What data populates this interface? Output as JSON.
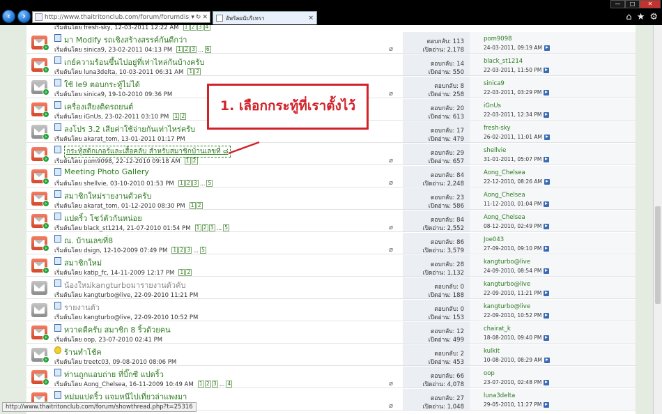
{
  "browser": {
    "url": "http://www.thaitritonclub.com/forum/forumdisplay.ph",
    "tab_title": "อัพรัลผนับริเทรา",
    "tab_close": "×",
    "window_buttons": [
      "—",
      "□",
      "✕"
    ],
    "status_url": "http://www.thaitritonclub.com/forum/showthread.php?t=25316"
  },
  "top_row": {
    "starter": "เริ่มต้นโดย fresh-sky, 12-03-2011 12:22 AM",
    "pages": [
      "1",
      "2",
      "3",
      "4"
    ]
  },
  "threads": [
    {
      "title": "มา Modify รถเชิงสร้างสรรค์กันดีกว่า",
      "state": "hot",
      "new": true,
      "icon": "doc",
      "grey": false,
      "boxed": false,
      "starter": "เริ่มต้นโดย sinica9, 23-02-2011 04:13 PM",
      "pages": [
        "1",
        "2",
        "3",
        "...",
        "6"
      ],
      "attach": true,
      "replies": "ตอบกลับ: 113",
      "views": "เปิดอ่าน: 2,178",
      "lp_user": "pom9098",
      "lp_date": "24-03-2011, 09:19 AM"
    },
    {
      "title": "เกย์ความร้อนขึ้นไปอยู่ที่เท่าไหล่กันบ้างครับ",
      "state": "hot",
      "new": true,
      "icon": "doc",
      "grey": false,
      "boxed": false,
      "starter": "เริ่มต้นโดย luna3delta, 10-03-2011 06:31 AM",
      "pages": [
        "1",
        "2"
      ],
      "attach": false,
      "replies": "ตอบกลับ: 14",
      "views": "เปิดอ่าน: 550",
      "lp_user": "black_st1214",
      "lp_date": "22-03-2011, 11:50 PM"
    },
    {
      "title": "ใช้ Ie9 ตอบกระทู้ไม่ได้",
      "state": "cold",
      "new": true,
      "icon": "doc",
      "grey": false,
      "boxed": false,
      "starter": "เริ่มต้นโดย sinica9, 19-10-2010 09:36 PM",
      "pages": [],
      "attach": true,
      "replies": "ตอบกลับ: 8",
      "views": "เปิดอ่าน: 258",
      "lp_user": "sinica9",
      "lp_date": "22-03-2011, 03:29 PM"
    },
    {
      "title": "เครื่องเสียงติดรถยนต์",
      "state": "hot",
      "new": true,
      "icon": "doc",
      "grey": false,
      "boxed": false,
      "starter": "เริ่มต้นโดย iGnUs, 23-02-2011 03:10 PM",
      "pages": [
        "1",
        "2"
      ],
      "attach": false,
      "replies": "ตอบกลับ: 20",
      "views": "เปิดอ่าน: 613",
      "lp_user": "iGnUs",
      "lp_date": "22-03-2011, 12:34 PM"
    },
    {
      "title": "ลงโปร 3.2 เสียค่าใช้จ่ายกันเท่าไหร่ครับ",
      "state": "cold",
      "new": true,
      "icon": "doc",
      "grey": false,
      "boxed": false,
      "starter": "เริ่มต้นโดย akarat_tom, 13-01-2011 01:17 PM",
      "pages": [],
      "attach": false,
      "replies": "ตอบกลับ: 17",
      "views": "เปิดอ่าน: 479",
      "lp_user": "fresh-sky",
      "lp_date": "26-02-2011, 11:01 AM"
    },
    {
      "title": "กระทู้สติกเกอร์และเสื้อคลับ สำหรับสมาชิกบ้านเลขที่ ๘",
      "state": "hot",
      "new": true,
      "icon": "doc",
      "grey": false,
      "boxed": true,
      "starter": "เริ่มต้นโดย pom9098, 22-12-2010 09:18 AM",
      "pages": [
        "1",
        "2"
      ],
      "attach": true,
      "replies": "ตอบกลับ: 29",
      "views": "เปิดอ่าน: 657",
      "lp_user": "shellvie",
      "lp_date": "31-01-2011, 05:07 PM"
    },
    {
      "title": "Meeting Photo Gallery",
      "state": "hot",
      "new": true,
      "icon": "doc",
      "grey": false,
      "boxed": false,
      "starter": "เริ่มต้นโดย shellvie, 03-10-2010 01:53 PM",
      "pages": [
        "1",
        "2",
        "3",
        "...",
        "5"
      ],
      "attach": true,
      "replies": "ตอบกลับ: 84",
      "views": "เปิดอ่าน: 2,248",
      "lp_user": "Aong_Chelsea",
      "lp_date": "22-12-2010, 08:26 AM"
    },
    {
      "title": "สมาชิกใหม่รายงานตัวครับ",
      "state": "hot",
      "new": true,
      "icon": "doc",
      "grey": false,
      "boxed": false,
      "starter": "เริ่มต้นโดย akarat_tom, 01-12-2010 08:30 PM",
      "pages": [
        "1",
        "2"
      ],
      "attach": false,
      "replies": "ตอบกลับ: 23",
      "views": "เปิดอ่าน: 586",
      "lp_user": "Aong_Chelsea",
      "lp_date": "11-12-2010, 01:04 PM"
    },
    {
      "title": "แปดริ้ว โชว์ตัวกันหน่อย",
      "state": "hot",
      "new": true,
      "icon": "doc",
      "grey": false,
      "boxed": false,
      "starter": "เริ่มต้นโดย black_st1214, 21-07-2010 01:54 PM",
      "pages": [
        "1",
        "2",
        "3",
        "...",
        "5"
      ],
      "attach": true,
      "replies": "ตอบกลับ: 84",
      "views": "เปิดอ่าน: 2,552",
      "lp_user": "Aong_Chelsea",
      "lp_date": "08-12-2010, 02:49 PM"
    },
    {
      "title": "ณ. บ้านเลขที่8",
      "state": "hot",
      "new": true,
      "icon": "doc",
      "grey": false,
      "boxed": false,
      "starter": "เริ่มต้นโดย dsign, 12-10-2009 07:49 PM",
      "pages": [
        "1",
        "2",
        "3",
        "...",
        "5"
      ],
      "attach": true,
      "replies": "ตอบกลับ: 86",
      "views": "เปิดอ่าน: 3,579",
      "lp_user": "Joe043",
      "lp_date": "27-09-2010, 09:10 PM"
    },
    {
      "title": "สมาชิกใหม่",
      "state": "hot",
      "new": true,
      "icon": "doc",
      "grey": false,
      "boxed": false,
      "starter": "เริ่มต้นโดย katip_fc, 14-11-2009 12:17 PM",
      "pages": [
        "1",
        "2"
      ],
      "attach": false,
      "replies": "ตอบกลับ: 28",
      "views": "เปิดอ่าน: 1,132",
      "lp_user": "kangturbo@live",
      "lp_date": "24-09-2010, 08:54 PM"
    },
    {
      "title": "น้องใหม่kangturboมารายงานตัวคับ",
      "state": "cold",
      "new": false,
      "icon": "doc",
      "grey": true,
      "boxed": false,
      "starter": "เริ่มต้นโดย kangturbo@live, 22-09-2010 11:21 PM",
      "pages": [],
      "attach": false,
      "replies": "ตอบกลับ: 0",
      "views": "เปิดอ่าน: 188",
      "lp_user": "kangturbo@live",
      "lp_date": "22-09-2010, 11:21 PM"
    },
    {
      "title": "รายงานตัว",
      "state": "cold",
      "new": false,
      "icon": "doc",
      "grey": true,
      "boxed": false,
      "starter": "เริ่มต้นโดย kangturbo@live, 22-09-2010 10:52 PM",
      "pages": [],
      "attach": false,
      "replies": "ตอบกลับ: 0",
      "views": "เปิดอ่าน: 153",
      "lp_user": "kangturbo@live",
      "lp_date": "22-09-2010, 10:52 PM"
    },
    {
      "title": "หวาดดีครับ สมาชิก 8 ริ้วด้วยคน",
      "state": "hot",
      "new": true,
      "icon": "doc",
      "grey": false,
      "boxed": false,
      "starter": "เริ่มต้นโดย oop, 23-07-2010 02:41 PM",
      "pages": [],
      "attach": false,
      "replies": "ตอบกลับ: 12",
      "views": "เปิดอ่าน: 499",
      "lp_user": "chairat_k",
      "lp_date": "18-08-2010, 09:40 PM"
    },
    {
      "title": "ร้านทำโช้ค",
      "state": "cold",
      "new": true,
      "icon": "smile",
      "grey": false,
      "boxed": false,
      "starter": "เริ่มต้นโดย treetc03, 09-08-2010 08:06 PM",
      "pages": [],
      "attach": false,
      "replies": "ตอบกลับ: 2",
      "views": "เปิดอ่าน: 453",
      "lp_user": "kulkit",
      "lp_date": "10-08-2010, 08:29 AM"
    },
    {
      "title": "ท่านถูกแอบถ่าย ที่บิ๊กซี แปดริ้ว",
      "state": "hot",
      "new": true,
      "icon": "doc",
      "grey": false,
      "boxed": false,
      "starter": "เริ่มต้นโดย Aong_Chelsea, 16-11-2009 10:49 AM",
      "pages": [
        "1",
        "2",
        "3",
        "...",
        "4"
      ],
      "attach": true,
      "replies": "ตอบกลับ: 66",
      "views": "เปิดอ่าน: 4,078",
      "lp_user": "oop",
      "lp_date": "23-07-2010, 02:48 PM"
    },
    {
      "title": "หม่มแปดริ้ว แจมหนีไปเที่ยวล่าแพงมา",
      "state": "hot",
      "new": true,
      "icon": "doc",
      "grey": false,
      "boxed": false,
      "starter": "เริ่มต้นโดย Aong_Chelsea, 12-10-2009",
      "pages": [
        "1",
        "2"
      ],
      "attach": true,
      "replies": "ตอบกลับ: 27",
      "views": "เปิดอ่าน: 1,048",
      "lp_user": "luna3delta",
      "lp_date": "29-05-2010, 11:27 PM"
    }
  ],
  "annotation": {
    "text": "1. เลือกกระทู้ที่เราตั้งไว้",
    "color": "#d1222a"
  }
}
